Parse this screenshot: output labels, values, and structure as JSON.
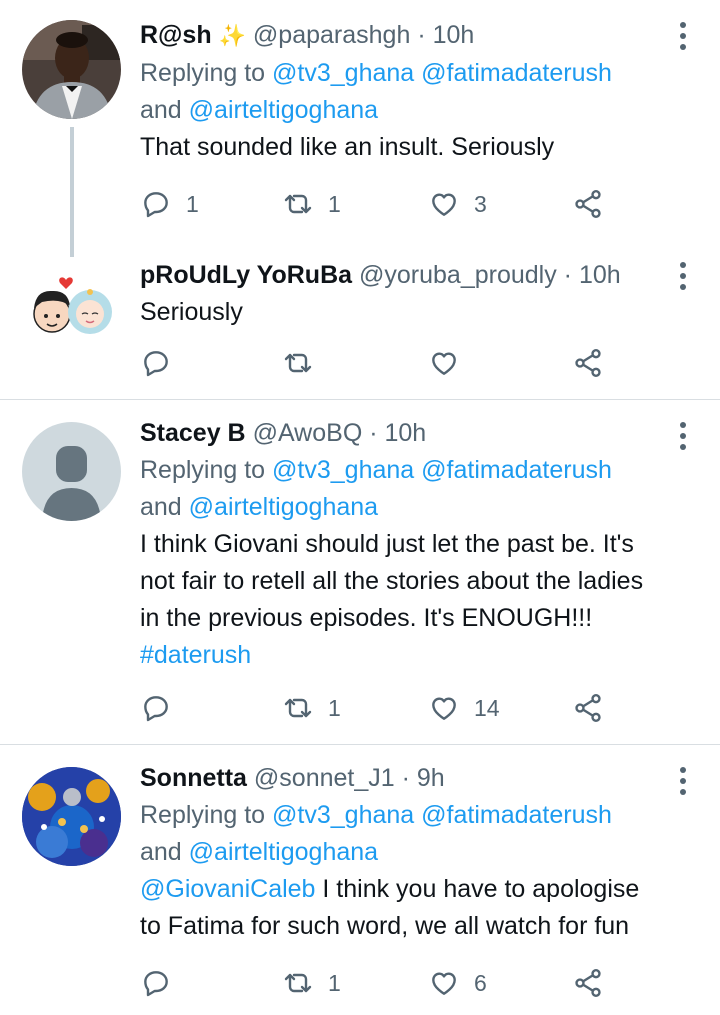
{
  "tweets": [
    {
      "name": "R@sh",
      "emoji": "✨",
      "handle": "@paparashgh",
      "sep": "·",
      "time": "10h",
      "replying_prefix": "Replying to",
      "reply_mentions": [
        "@tv3_ghana",
        "@fatimadaterush"
      ],
      "reply_and": "and",
      "reply_last": "@airteltigoghana",
      "text": "That sounded like an insult. Seriously",
      "replies": "1",
      "retweets": "1",
      "likes": "3"
    },
    {
      "name": "pRoUdLy YoRuBa",
      "handle": "@yoruba_proudly",
      "sep": "·",
      "time": "10h",
      "text": "Seriously",
      "replies": "",
      "retweets": "",
      "likes": ""
    },
    {
      "name": "Stacey B",
      "handle": "@AwoBQ",
      "sep": "·",
      "time": "10h",
      "replying_prefix": "Replying to",
      "reply_mentions": [
        "@tv3_ghana",
        "@fatimadaterush"
      ],
      "reply_and": "and",
      "reply_last": "@airteltigoghana",
      "text_lines": [
        "I think Giovani should just let the past be. It's",
        "not fair to retell all the stories about the ladies",
        "in the previous episodes. It's ENOUGH!!!"
      ],
      "hashtag": "#daterush",
      "replies": "",
      "retweets": "1",
      "likes": "14"
    },
    {
      "name": "Sonnetta",
      "handle": "@sonnet_J1",
      "sep": "·",
      "time": "9h",
      "replying_prefix": "Replying to",
      "reply_mentions": [
        "@tv3_ghana",
        "@fatimadaterush"
      ],
      "reply_and": "and",
      "reply_last": "@airteltigoghana",
      "mention_start": "@GiovaniCaleb",
      "text_first": " I think you have to apologise",
      "text_second": "to Fatima for such word, we all watch for fun",
      "replies": "",
      "retweets": "1",
      "likes": "6"
    }
  ],
  "colors": {
    "accent": "#1d9bf0",
    "secondary_text": "#536471",
    "divider": "#d9dee2",
    "thread_line": "#c4cfd6"
  },
  "icons": [
    "reply-icon",
    "retweet-icon",
    "like-icon",
    "share-icon",
    "more-icon"
  ]
}
